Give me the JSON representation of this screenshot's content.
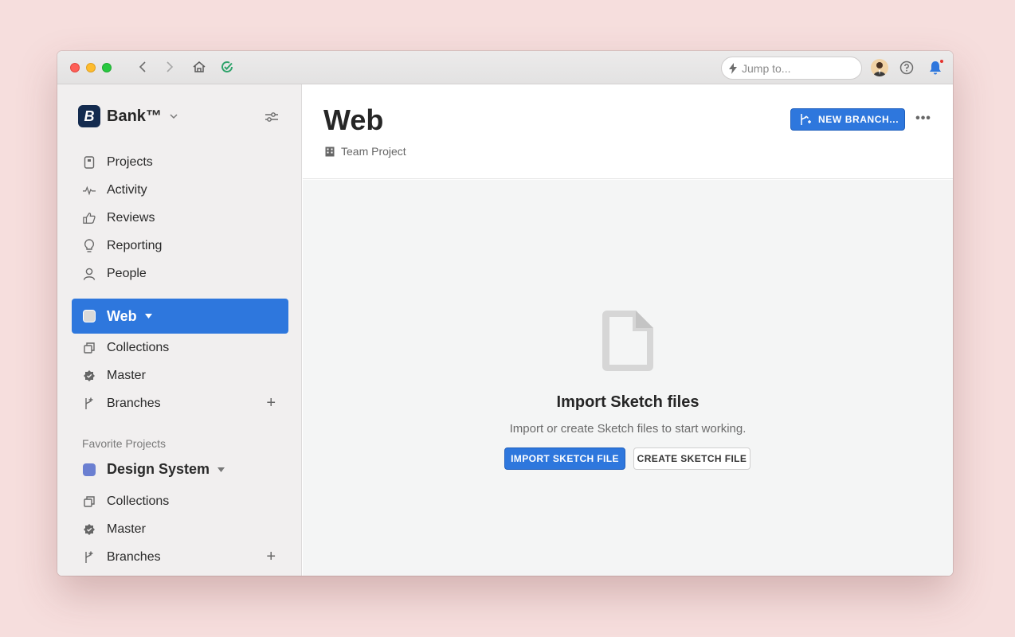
{
  "titlebar": {
    "jump_placeholder": "Jump to..."
  },
  "sidebar": {
    "org_name": "Bank™",
    "org_logo_letter": "B",
    "nav": [
      {
        "label": "Projects",
        "icon": "notebook-icon"
      },
      {
        "label": "Activity",
        "icon": "activity-icon"
      },
      {
        "label": "Reviews",
        "icon": "thumbs-up-icon"
      },
      {
        "label": "Reporting",
        "icon": "lightbulb-icon"
      },
      {
        "label": "People",
        "icon": "person-icon"
      }
    ],
    "current_project": {
      "name": "Web",
      "color": "#d9d9d9",
      "items": [
        {
          "label": "Collections",
          "icon": "collections-icon"
        },
        {
          "label": "Master",
          "icon": "verified-badge-icon"
        },
        {
          "label": "Branches",
          "icon": "branch-icon"
        }
      ]
    },
    "favorites_label": "Favorite Projects",
    "favorite_project": {
      "name": "Design System",
      "color": "#6b7fd1",
      "items": [
        {
          "label": "Collections",
          "icon": "collections-icon"
        },
        {
          "label": "Master",
          "icon": "verified-badge-icon"
        },
        {
          "label": "Branches",
          "icon": "branch-icon"
        }
      ]
    }
  },
  "main": {
    "title": "Web",
    "subtitle": "Team Project",
    "new_branch_label": "NEW BRANCH...",
    "more_label": "•••",
    "empty_title": "Import Sketch files",
    "empty_desc": "Import or create Sketch files to start working.",
    "import_label": "IMPORT SKETCH FILE",
    "create_label": "CREATE SKETCH FILE"
  },
  "colors": {
    "accent": "#2e77dd",
    "background": "#f6dedd"
  }
}
